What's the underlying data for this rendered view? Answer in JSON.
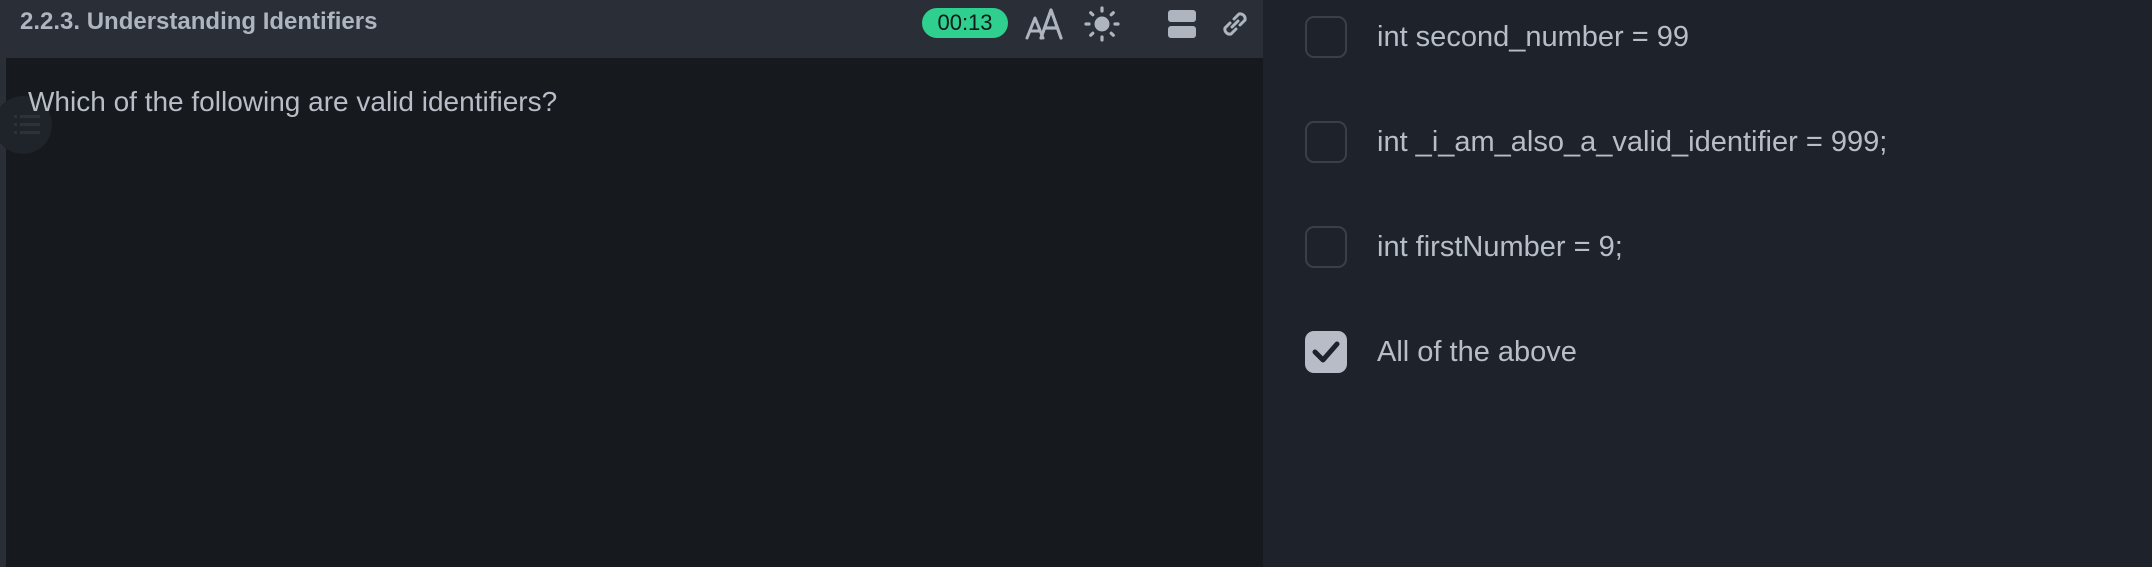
{
  "header": {
    "title": "2.2.3. Understanding Identifiers",
    "timer": "00:13",
    "icons": [
      "font-size-icon",
      "theme-sun-icon",
      "layout-icon",
      "link-icon"
    ]
  },
  "question": {
    "text": "Which of the following are valid identifiers?"
  },
  "options": [
    {
      "label": "int second_number = 99",
      "checked": false
    },
    {
      "label": "int _i_am_also_a_valid_identifier = 999;",
      "checked": false
    },
    {
      "label": "int firstNumber = 9;",
      "checked": false
    },
    {
      "label": "All of the above",
      "checked": true
    }
  ],
  "colors": {
    "timer_bg": "#2ecf8f",
    "header_bg": "#292e37",
    "left_bg": "#16191e",
    "right_bg": "#1e232b",
    "checked_bg": "#b7bcc6"
  }
}
